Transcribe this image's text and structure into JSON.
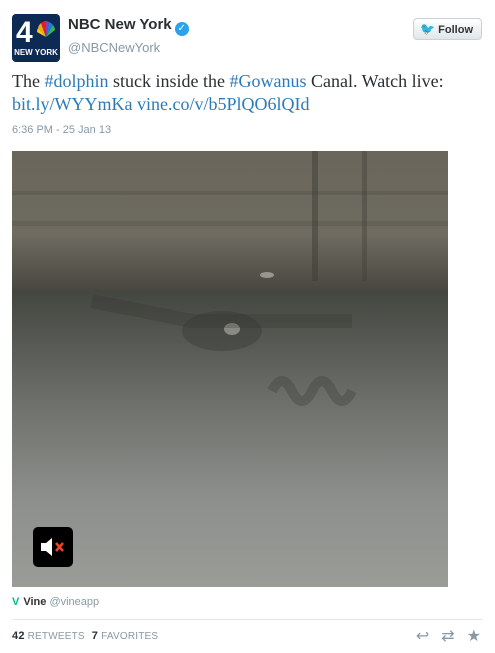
{
  "account": {
    "avatar_number": "4",
    "avatar_subtitle": "NEW YORK",
    "display_name": "NBC New York",
    "handle": "@NBCNewYork",
    "verified_icon": "verified-badge-icon"
  },
  "follow_button": {
    "label": "Follow",
    "icon": "twitter-bird-icon"
  },
  "tweet": {
    "text_1": "The ",
    "hashtag_1": "#dolphin",
    "text_2": " stuck inside the ",
    "hashtag_2": "#Gowanus",
    "text_3": " Canal. Watch live: ",
    "link_1": "bit.ly/WYYmKa",
    "text_4": " ",
    "link_2": "vine.co/v/b5PlQO6lQId",
    "timestamp": "6:36 PM - 25 Jan 13"
  },
  "media": {
    "mute_icon": "speaker-muted-icon"
  },
  "vine": {
    "logo": "V",
    "name": "Vine",
    "handle": "@vineapp"
  },
  "stats": {
    "retweets_count": "42",
    "retweets_label": "RETWEETS",
    "favorites_count": "7",
    "favorites_label": "FAVORITES"
  },
  "actions": {
    "reply_icon": "reply-icon",
    "retweet_icon": "retweet-icon",
    "favorite_icon": "star-icon"
  },
  "colors": {
    "link": "#2b7bb9",
    "verified": "#2aa3ef",
    "vine": "#00bf8f"
  }
}
